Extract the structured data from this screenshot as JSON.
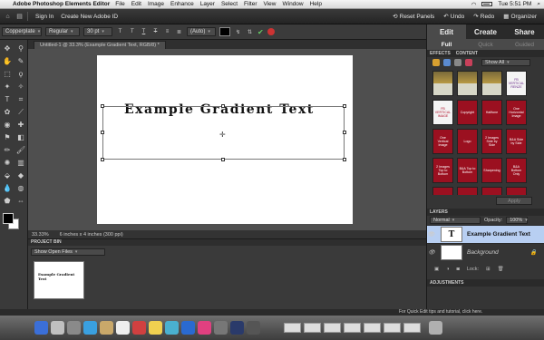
{
  "menubar": {
    "apple_glyph": "",
    "app_name": "Adobe Photoshop Elements Editor",
    "items": [
      "File",
      "Edit",
      "Image",
      "Enhance",
      "Layer",
      "Select",
      "Filter",
      "View",
      "Window",
      "Help"
    ],
    "time": "Tue 5:51 PM"
  },
  "topbar": {
    "sign_in": "Sign In",
    "create_id": "Create New Adobe ID",
    "reset_panels": "Reset Panels",
    "undo": "Undo",
    "redo": "Redo",
    "organizer": "Organizer"
  },
  "options": {
    "font_family": "Copperplate",
    "font_style": "Regular",
    "font_size": "30 pt",
    "leading": "(Auto)"
  },
  "document": {
    "tab_title": "Untitled-1 @ 33.3% (Example Gradient Text, RGB/8) *",
    "text": "Example Gradient Text",
    "zoom": "33.33%",
    "doc_info": "6 inches x 4 inches (300 ppi)"
  },
  "project_bin": {
    "title": "PROJECT BIN",
    "filter": "Show Open Files",
    "thumb_text": "Example Gradient Text"
  },
  "right_panel": {
    "modes": [
      "Edit",
      "Create",
      "Share"
    ],
    "submodes": [
      "Full",
      "Quick",
      "Guided"
    ],
    "effects_tab": "EFFECTS",
    "content_tab": "CONTENT",
    "show_filter": "Show All",
    "apply": "Apply",
    "fx_items": [
      {
        "label": "",
        "style": "img"
      },
      {
        "label": "",
        "style": "img"
      },
      {
        "label": "",
        "style": "img"
      },
      {
        "label": "FB VERTICAL RENZE",
        "style": "white"
      },
      {
        "label": "FB VERTICAL IMAGE",
        "style": "whitered"
      },
      {
        "label": "Copyright",
        "style": "red"
      },
      {
        "label": "Halftone",
        "style": "red"
      },
      {
        "label": "One Horizontal Image",
        "style": "red"
      },
      {
        "label": "One Vertical Image",
        "style": "red"
      },
      {
        "label": "Logo",
        "style": "red"
      },
      {
        "label": "2 Images Side by Side",
        "style": "red"
      },
      {
        "label": "B&A Side by Side",
        "style": "red"
      },
      {
        "label": "2 Images Top to Bottom",
        "style": "red"
      },
      {
        "label": "B&A Top to Bottom",
        "style": "red"
      },
      {
        "label": "Sharpening",
        "style": "red"
      },
      {
        "label": "B&A Bottom Only",
        "style": "red"
      },
      {
        "label": "B&A Snap Right Only",
        "style": "red"
      },
      {
        "label": "©",
        "style": "red"
      },
      {
        "label": "© Ex Text Copy",
        "style": "red"
      },
      {
        "label": "©Image Copyright",
        "style": "red"
      }
    ],
    "layers_title": "LAYERS",
    "blend_mode": "Normal",
    "opacity_label": "Opacity:",
    "opacity_value": "100%",
    "layers": [
      {
        "name": "Example Gradient Text",
        "thumb": "T"
      },
      {
        "name": "Background",
        "thumb": ""
      }
    ],
    "lock_label": "Lock:",
    "adjustments_title": "ADJUSTMENTS"
  },
  "tip": "For Quick Edit tips and tutorial, click here."
}
